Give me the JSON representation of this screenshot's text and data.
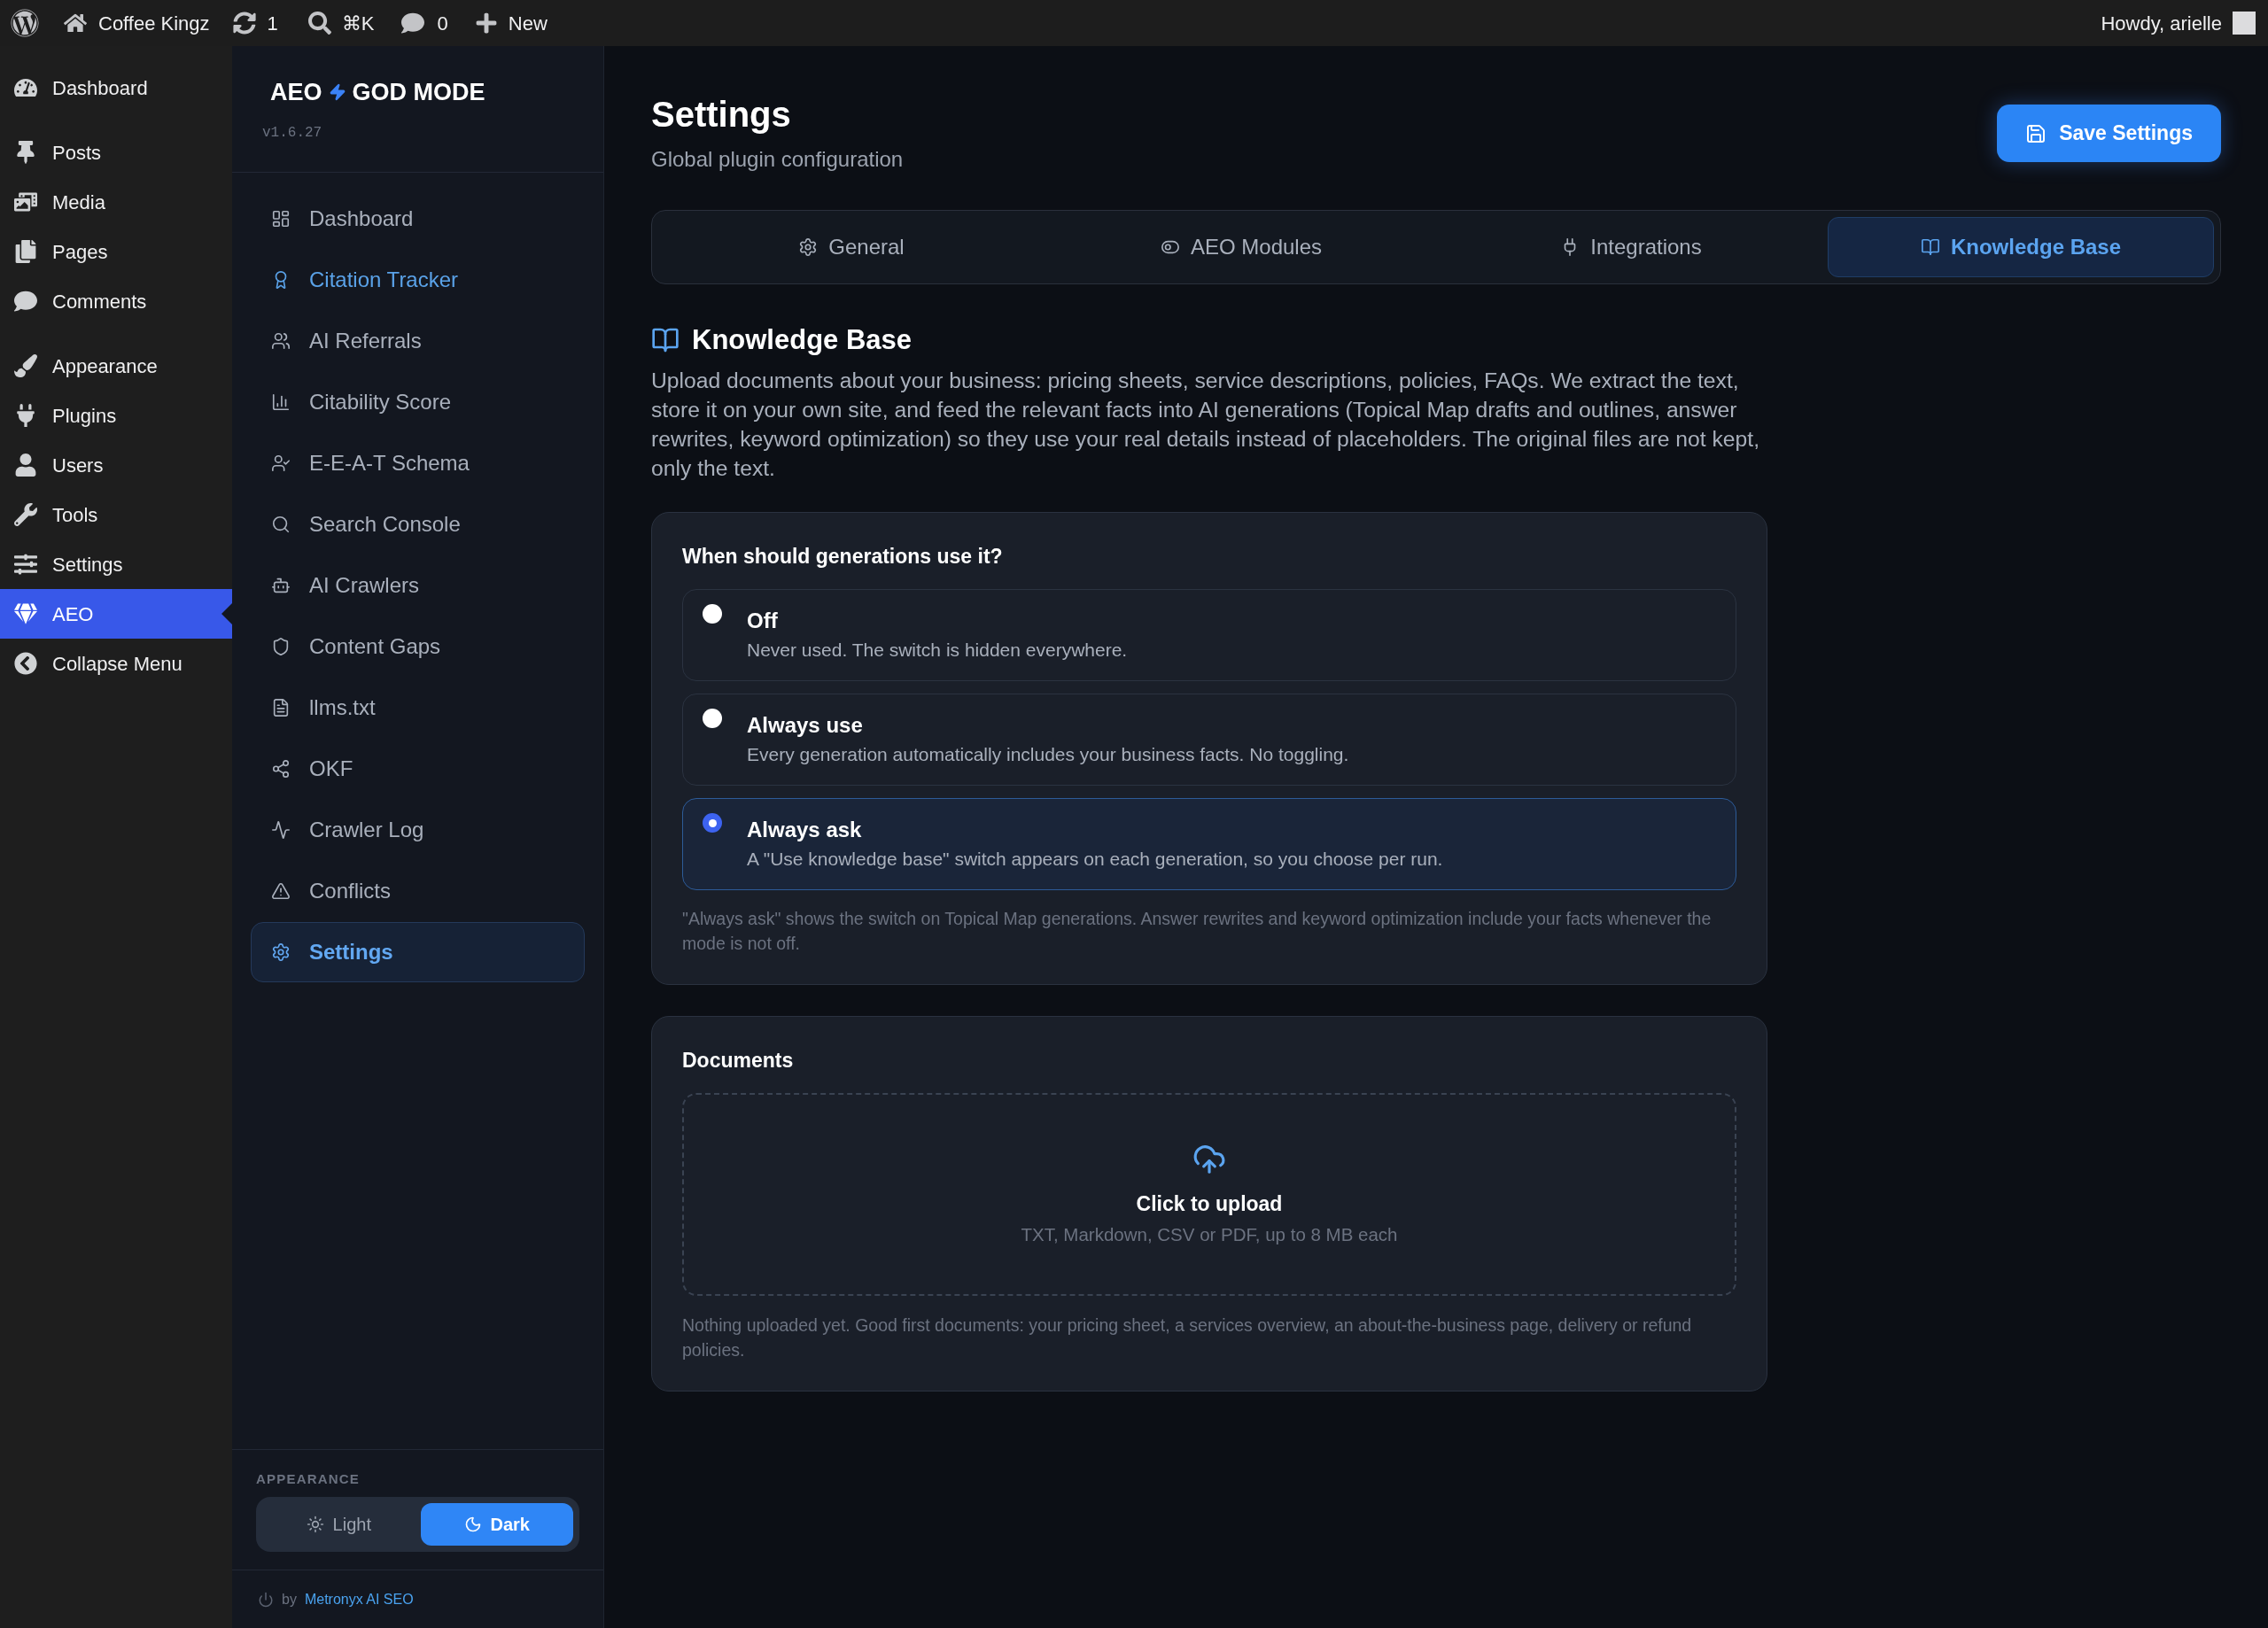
{
  "admin_bar": {
    "site_name": "Coffee Kingz",
    "updates": "1",
    "search_shortcut": "⌘K",
    "comments": "0",
    "new_label": "New",
    "greeting": "Howdy, arielle"
  },
  "wp_menu": {
    "sections": [
      {
        "items": [
          {
            "label": "Dashboard",
            "selected": false
          }
        ]
      },
      {
        "items": [
          {
            "label": "Posts",
            "selected": false
          },
          {
            "label": "Media",
            "selected": false
          },
          {
            "label": "Pages",
            "selected": false
          },
          {
            "label": "Comments",
            "selected": false
          }
        ]
      },
      {
        "items": [
          {
            "label": "Appearance",
            "selected": false
          },
          {
            "label": "Plugins",
            "selected": false
          },
          {
            "label": "Users",
            "selected": false
          },
          {
            "label": "Tools",
            "selected": false
          },
          {
            "label": "Settings",
            "selected": false
          },
          {
            "label": "AEO",
            "selected": true
          }
        ]
      }
    ],
    "collapse": "Collapse Menu"
  },
  "plugin_sidebar": {
    "brand": {
      "name": "AEO",
      "mode": "GOD MODE"
    },
    "version": "v1.6.27",
    "nav": [
      {
        "label": "Dashboard",
        "selected": false,
        "highlighted": false
      },
      {
        "label": "Citation Tracker",
        "selected": false,
        "highlighted": true
      },
      {
        "label": "AI Referrals",
        "selected": false,
        "highlighted": false
      },
      {
        "label": "Citability Score",
        "selected": false,
        "highlighted": false
      },
      {
        "label": "E-E-A-T Schema",
        "selected": false,
        "highlighted": false
      },
      {
        "label": "Search Console",
        "selected": false,
        "highlighted": false
      },
      {
        "label": "AI Crawlers",
        "selected": false,
        "highlighted": false
      },
      {
        "label": "Content Gaps",
        "selected": false,
        "highlighted": false
      },
      {
        "label": "llms.txt",
        "selected": false,
        "highlighted": false
      },
      {
        "label": "OKF",
        "selected": false,
        "highlighted": false
      },
      {
        "label": "Crawler Log",
        "selected": false,
        "highlighted": false
      },
      {
        "label": "Conflicts",
        "selected": false,
        "highlighted": false
      },
      {
        "label": "Settings",
        "selected": true,
        "highlighted": false
      }
    ],
    "appearance": {
      "heading": "APPEARANCE",
      "options": [
        {
          "label": "Light",
          "selected": false
        },
        {
          "label": "Dark",
          "selected": true
        }
      ]
    },
    "credit": {
      "prefix": "by",
      "link": "Metronyx AI SEO"
    }
  },
  "page": {
    "title": "Settings",
    "subtitle": "Global plugin configuration",
    "save_button": "Save Settings",
    "tabs": [
      {
        "label": "General",
        "selected": false
      },
      {
        "label": "AEO Modules",
        "selected": false
      },
      {
        "label": "Integrations",
        "selected": false
      },
      {
        "label": "Knowledge Base",
        "selected": true
      }
    ]
  },
  "knowledge_base": {
    "heading": "Knowledge Base",
    "description": "Upload documents about your business: pricing sheets, service descriptions, policies, FAQs. We extract the text, store it on your own site, and feed the relevant facts into AI generations (Topical Map drafts and outlines, answer rewrites, keyword optimization) so they use your real details instead of placeholders. The original files are not kept, only the text.",
    "usage_card": {
      "question": "When should generations use it?",
      "options": [
        {
          "label": "Off",
          "description": "Never used. The switch is hidden everywhere.",
          "selected": false
        },
        {
          "label": "Always use",
          "description": "Every generation automatically includes your business facts. No toggling.",
          "selected": false
        },
        {
          "label": "Always ask",
          "description": "A \"Use knowledge base\" switch appears on each generation, so you choose per run.",
          "selected": true
        }
      ],
      "note": "\"Always ask\" shows the switch on Topical Map generations. Answer rewrites and keyword optimization include your facts whenever the mode is not off."
    },
    "documents_card": {
      "heading": "Documents",
      "upload_title": "Click to upload",
      "upload_hint": "TXT, Markdown, CSV or PDF, up to 8 MB each",
      "note": "Nothing uploaded yet. Good first documents: your pricing sheet, a services overview, an about-the-business page, delivery or refund policies."
    }
  }
}
